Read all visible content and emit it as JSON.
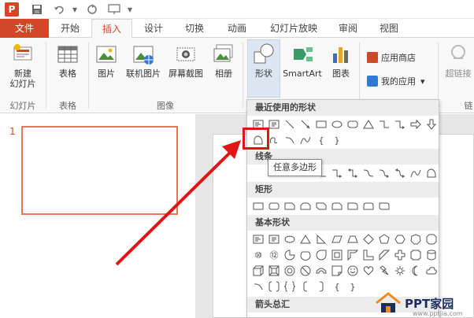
{
  "qat": {
    "app_icon": "P",
    "save_icon": "save-icon",
    "undo_icon": "undo-icon",
    "redo_icon": "redo-icon",
    "present_icon": "present-icon"
  },
  "tabs": [
    {
      "label": "文件"
    },
    {
      "label": "开始"
    },
    {
      "label": "插入"
    },
    {
      "label": "设计"
    },
    {
      "label": "切换"
    },
    {
      "label": "动画"
    },
    {
      "label": "幻灯片放映"
    },
    {
      "label": "审阅"
    },
    {
      "label": "视图"
    }
  ],
  "ribbon": {
    "new_slide": "新建",
    "new_slide_2": "幻灯片",
    "table": "表格",
    "picture": "图片",
    "online_picture": "联机图片",
    "screenshot": "屏幕截图",
    "album": "相册",
    "shapes": "形状",
    "smartart": "SmartArt",
    "chart": "图表",
    "app_store": "应用商店",
    "my_apps": "我的应用",
    "hyperlink": "超链接",
    "group_slides": "幻灯片",
    "group_table": "表格",
    "group_images": "图像",
    "group_link": "链"
  },
  "slide_pane": {
    "slide_number": "1"
  },
  "dropdown": {
    "recent_header": "最近使用的形状",
    "lines_header": "线条",
    "rect_header": "矩形",
    "basic_header": "基本形状",
    "arrows_header": "箭头总汇",
    "brace_left": "{",
    "brace_right": "}",
    "num_10": "⑩",
    "num_12": "⑫"
  },
  "tooltip": {
    "text": "任意多边形"
  },
  "watermark": {
    "brand": "PPT家园",
    "url": "www.pptjia.com"
  },
  "colors": {
    "accent": "#d24726",
    "highlight": "#e01515",
    "thumb_border": "#e8745a"
  }
}
